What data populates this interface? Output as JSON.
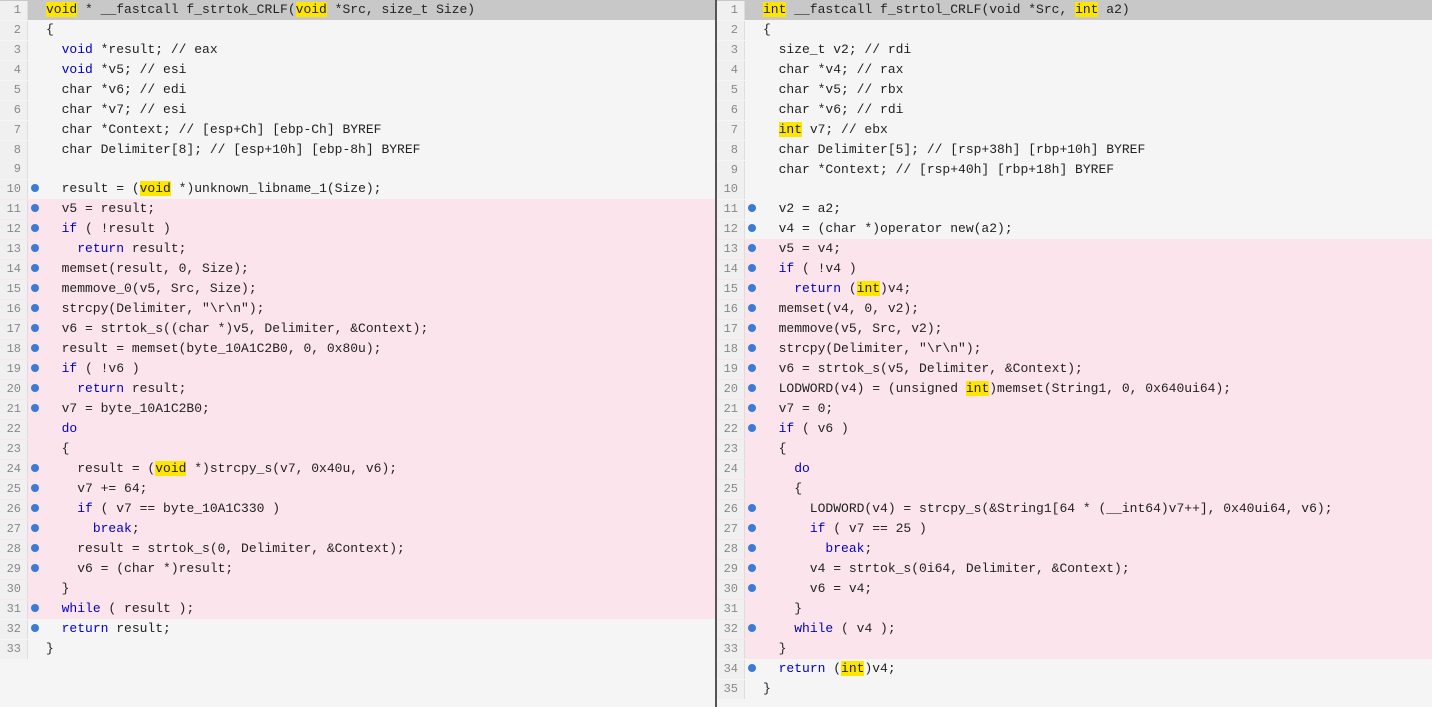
{
  "pane1": {
    "title": "f_strtok_CRLF",
    "header": "void * __fastcall f_strtok_CRLF(void *Src, size_t Size)",
    "lines": [
      {
        "num": 1,
        "dot": false,
        "bg": "header",
        "html": "<span class='hl-yellow'>void</span> * __fastcall f_strtok_CRLF(<span class='hl-yellow'>void</span> *Src, size_t Size)"
      },
      {
        "num": 2,
        "dot": false,
        "bg": "normal",
        "html": "{"
      },
      {
        "num": 3,
        "dot": false,
        "bg": "normal",
        "html": "  <span class='kw-type'>void</span> *result; // eax"
      },
      {
        "num": 4,
        "dot": false,
        "bg": "normal",
        "html": "  <span class='kw-type'>void</span> *v5; // esi"
      },
      {
        "num": 5,
        "dot": false,
        "bg": "normal",
        "html": "  char *v6; // edi"
      },
      {
        "num": 6,
        "dot": false,
        "bg": "normal",
        "html": "  char *v7; // esi"
      },
      {
        "num": 7,
        "dot": false,
        "bg": "normal",
        "html": "  char *Context; // [esp+Ch] [ebp-Ch] BYREF"
      },
      {
        "num": 8,
        "dot": false,
        "bg": "normal",
        "html": "  char Delimiter[8]; // [esp+10h] [ebp-8h] BYREF"
      },
      {
        "num": 9,
        "dot": false,
        "bg": "normal",
        "html": ""
      },
      {
        "num": 10,
        "dot": true,
        "bg": "normal",
        "html": "  result = (<span class='hl-yellow'>void</span> *)unknown_libname_1(Size);"
      },
      {
        "num": 11,
        "dot": true,
        "bg": "pink",
        "html": "  v5 = result;"
      },
      {
        "num": 12,
        "dot": true,
        "bg": "pink",
        "html": "  <span class='kw'>if</span> ( !result )"
      },
      {
        "num": 13,
        "dot": true,
        "bg": "pink",
        "html": "    <span class='kw'>return</span> result;"
      },
      {
        "num": 14,
        "dot": true,
        "bg": "pink",
        "html": "  memset(result, 0, Size);"
      },
      {
        "num": 15,
        "dot": true,
        "bg": "pink",
        "html": "  memmove_0(v5, Src, Size);"
      },
      {
        "num": 16,
        "dot": true,
        "bg": "pink",
        "html": "  strcpy(Delimiter, \"\\r\\n\");"
      },
      {
        "num": 17,
        "dot": true,
        "bg": "pink",
        "html": "  v6 = strtok_s((char *)v5, Delimiter, &amp;Context);"
      },
      {
        "num": 18,
        "dot": true,
        "bg": "pink",
        "html": "  result = memset(byte_10A1C2B0, 0, 0x80u);"
      },
      {
        "num": 19,
        "dot": true,
        "bg": "pink",
        "html": "  <span class='kw'>if</span> ( !v6 )"
      },
      {
        "num": 20,
        "dot": true,
        "bg": "pink",
        "html": "    <span class='kw'>return</span> result;"
      },
      {
        "num": 21,
        "dot": true,
        "bg": "pink",
        "html": "  v7 = byte_10A1C2B0;"
      },
      {
        "num": 22,
        "dot": false,
        "bg": "pink",
        "html": "  <span class='kw'>do</span>"
      },
      {
        "num": 23,
        "dot": false,
        "bg": "pink",
        "html": "  {"
      },
      {
        "num": 24,
        "dot": true,
        "bg": "pink",
        "html": "    result = (<span class='hl-yellow'>void</span> *)strcpy_s(v7, 0x40u, v6);"
      },
      {
        "num": 25,
        "dot": true,
        "bg": "pink",
        "html": "    v7 += 64;"
      },
      {
        "num": 26,
        "dot": true,
        "bg": "pink",
        "html": "    <span class='kw'>if</span> ( v7 == byte_10A1C330 )"
      },
      {
        "num": 27,
        "dot": true,
        "bg": "pink",
        "html": "      <span class='kw'>break</span>;"
      },
      {
        "num": 28,
        "dot": true,
        "bg": "pink",
        "html": "    result = strtok_s(0, Delimiter, &amp;Context);"
      },
      {
        "num": 29,
        "dot": true,
        "bg": "pink",
        "html": "    v6 = (char *)result;"
      },
      {
        "num": 30,
        "dot": false,
        "bg": "pink",
        "html": "  }"
      },
      {
        "num": 31,
        "dot": true,
        "bg": "pink",
        "html": "  <span class='kw'>while</span> ( result );"
      },
      {
        "num": 32,
        "dot": true,
        "bg": "normal",
        "html": "  <span class='kw'>return</span> result;"
      },
      {
        "num": 33,
        "dot": false,
        "bg": "normal",
        "html": "}"
      }
    ]
  },
  "pane2": {
    "title": "f_strtol_CRLF",
    "header": "int __fastcall f_strtol_CRLF(void *Src, int a2)",
    "lines": [
      {
        "num": 1,
        "dot": false,
        "bg": "header",
        "html": "<span class='hl-yellow'>int</span> __fastcall f_strtol_CRLF(void *Src, <span class='hl-yellow'>int</span> a2)"
      },
      {
        "num": 2,
        "dot": false,
        "bg": "normal",
        "html": "{"
      },
      {
        "num": 3,
        "dot": false,
        "bg": "normal",
        "html": "  size_t v2; // rdi"
      },
      {
        "num": 4,
        "dot": false,
        "bg": "normal",
        "html": "  char *v4; // rax"
      },
      {
        "num": 5,
        "dot": false,
        "bg": "normal",
        "html": "  char *v5; // rbx"
      },
      {
        "num": 6,
        "dot": false,
        "bg": "normal",
        "html": "  char *v6; // rdi"
      },
      {
        "num": 7,
        "dot": false,
        "bg": "normal",
        "html": "  <span class='hl-yellow'>int</span> v7; // ebx"
      },
      {
        "num": 8,
        "dot": false,
        "bg": "normal",
        "html": "  char Delimiter[5]; // [rsp+38h] [rbp+10h] BYREF"
      },
      {
        "num": 9,
        "dot": false,
        "bg": "normal",
        "html": "  char *Context; // [rsp+40h] [rbp+18h] BYREF"
      },
      {
        "num": 10,
        "dot": false,
        "bg": "normal",
        "html": ""
      },
      {
        "num": 11,
        "dot": true,
        "bg": "normal",
        "html": "  v2 = a2;"
      },
      {
        "num": 12,
        "dot": true,
        "bg": "normal",
        "html": "  v4 = (char *)operator new(a2);"
      },
      {
        "num": 13,
        "dot": true,
        "bg": "pink",
        "html": "  v5 = v4;"
      },
      {
        "num": 14,
        "dot": true,
        "bg": "pink",
        "html": "  <span class='kw'>if</span> ( !v4 )"
      },
      {
        "num": 15,
        "dot": true,
        "bg": "pink",
        "html": "    <span class='kw'>return</span> (<span class='hl-yellow'>int</span>)v4;"
      },
      {
        "num": 16,
        "dot": true,
        "bg": "pink",
        "html": "  memset(v4, 0, v2);"
      },
      {
        "num": 17,
        "dot": true,
        "bg": "pink",
        "html": "  memmove(v5, Src, v2);"
      },
      {
        "num": 18,
        "dot": true,
        "bg": "pink",
        "html": "  strcpy(Delimiter, \"\\r\\n\");"
      },
      {
        "num": 19,
        "dot": true,
        "bg": "pink",
        "html": "  v6 = strtok_s(v5, Delimiter, &amp;Context);"
      },
      {
        "num": 20,
        "dot": true,
        "bg": "pink",
        "html": "  LODWORD(v4) = (unsigned <span class='hl-yellow'>int</span>)memset(String1, 0, 0x640ui64);"
      },
      {
        "num": 21,
        "dot": true,
        "bg": "pink",
        "html": "  v7 = 0;"
      },
      {
        "num": 22,
        "dot": true,
        "bg": "pink",
        "html": "  <span class='kw'>if</span> ( v6 )"
      },
      {
        "num": 23,
        "dot": false,
        "bg": "pink",
        "html": "  {"
      },
      {
        "num": 24,
        "dot": false,
        "bg": "pink",
        "html": "    <span class='kw'>do</span>"
      },
      {
        "num": 25,
        "dot": false,
        "bg": "pink",
        "html": "    {"
      },
      {
        "num": 26,
        "dot": true,
        "bg": "pink",
        "html": "      LODWORD(v4) = strcpy_s(&amp;String1[64 * (__int64)v7++], 0x40ui64, v6);"
      },
      {
        "num": 27,
        "dot": true,
        "bg": "pink",
        "html": "      <span class='kw'>if</span> ( v7 == 25 )"
      },
      {
        "num": 28,
        "dot": true,
        "bg": "pink",
        "html": "        <span class='kw'>break</span>;"
      },
      {
        "num": 29,
        "dot": true,
        "bg": "pink",
        "html": "      v4 = strtok_s(0i64, Delimiter, &amp;Context);"
      },
      {
        "num": 30,
        "dot": true,
        "bg": "pink",
        "html": "      v6 = v4;"
      },
      {
        "num": 31,
        "dot": false,
        "bg": "pink",
        "html": "    }"
      },
      {
        "num": 32,
        "dot": true,
        "bg": "pink",
        "html": "    <span class='kw'>while</span> ( v4 );"
      },
      {
        "num": 33,
        "dot": false,
        "bg": "pink",
        "html": "  }"
      },
      {
        "num": 34,
        "dot": true,
        "bg": "normal",
        "html": "  <span class='kw'>return</span> (<span class='hl-yellow'>int</span>)v4;"
      },
      {
        "num": 35,
        "dot": false,
        "bg": "normal",
        "html": "}"
      }
    ]
  }
}
